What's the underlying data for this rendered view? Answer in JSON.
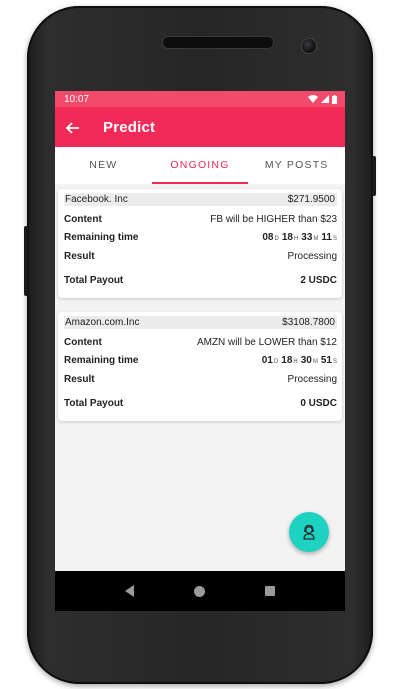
{
  "status_bar": {
    "time": "10:07"
  },
  "app_bar": {
    "title": "Predict",
    "back_icon": "arrow-left-icon"
  },
  "tabs": [
    {
      "label": "NEW",
      "active": false
    },
    {
      "label": "ONGOING",
      "active": true
    },
    {
      "label": "MY POSTS",
      "active": false
    }
  ],
  "colors": {
    "accent": "#f12a57",
    "status_bar": "#f34a6b",
    "fab": "#1dd2c0"
  },
  "cards": [
    {
      "company": "Facebook. Inc",
      "price": "$271.9500",
      "content_label": "Content",
      "content_value": "FB will be HIGHER than $23",
      "remaining_label": "Remaining time",
      "time": {
        "d": "08",
        "h": "18",
        "m": "33",
        "s": "11"
      },
      "result_label": "Result",
      "result_value": "Processing",
      "payout_label": "Total Payout",
      "payout_value": "2 USDC"
    },
    {
      "company": "Amazon.com.Inc",
      "price": "$3108.7800",
      "content_label": "Content",
      "content_value": "AMZN will be LOWER than $12",
      "remaining_label": "Remaining time",
      "time": {
        "d": "01",
        "h": "18",
        "m": "30",
        "s": "51"
      },
      "result_label": "Result",
      "result_value": "Processing",
      "payout_label": "Total Payout",
      "payout_value": "0 USDC"
    }
  ],
  "time_units": {
    "d": "D",
    "h": "H",
    "m": "M",
    "s": "S"
  },
  "fab": {
    "icon": "support-agent-icon"
  }
}
